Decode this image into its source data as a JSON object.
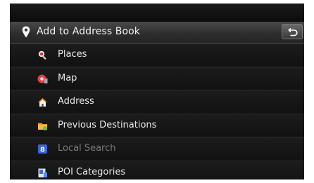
{
  "header": {
    "title": "Add to Address Book",
    "back_icon": "back-arrow-icon"
  },
  "menu": {
    "items": [
      {
        "label": "Places",
        "icon": "magnifier-icon",
        "enabled": true
      },
      {
        "label": "Map",
        "icon": "map-pin-icon",
        "enabled": true
      },
      {
        "label": "Address",
        "icon": "house-icon",
        "enabled": true
      },
      {
        "label": "Previous Destinations",
        "icon": "folder-icon",
        "enabled": true
      },
      {
        "label": "Local Search",
        "icon": "local-search-icon",
        "enabled": false
      },
      {
        "label": "POI Categories",
        "icon": "poi-flag-icon",
        "enabled": true
      }
    ]
  },
  "scrollbar": {
    "position_fraction": 0.0
  },
  "colors": {
    "background": "#0c0c0c",
    "text": "#e8e8e8",
    "disabled_text": "#7a7a7a"
  }
}
